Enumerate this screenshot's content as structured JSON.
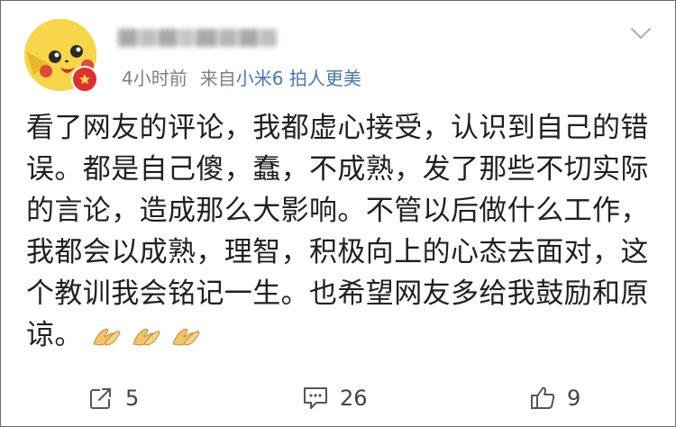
{
  "header": {
    "username_redacted": "",
    "time": "4小时前",
    "source_prefix": "来自",
    "device": "小米6",
    "device_suffix": " 拍人更美"
  },
  "post": {
    "text": "看了网友的评论，我都虚心接受，认识到自己的错误。都是自己傻，蠢，不成熟，发了那些不切实际的言论，造成那么大影响。不管以后做什么工作，我都会以成熟，理智，积极向上的心态去面对，这个教训我会铭记一生。也希望网友多给我鼓励和原谅。",
    "emoji": [
      "pray-hands",
      "pray-hands",
      "pray-hands"
    ]
  },
  "actions": {
    "repost_count": "5",
    "comment_count": "26",
    "like_count": "9"
  },
  "icons": {
    "avatar": "pikachu-avatar",
    "badge": "vip-badge-icon",
    "chevron": "chevron-down-icon",
    "repost": "repost-icon",
    "comment": "comment-icon",
    "like": "thumbs-up-icon"
  },
  "colors": {
    "link": "#4a77b5",
    "meta_gray": "#808080",
    "badge_red": "#e0302c"
  }
}
